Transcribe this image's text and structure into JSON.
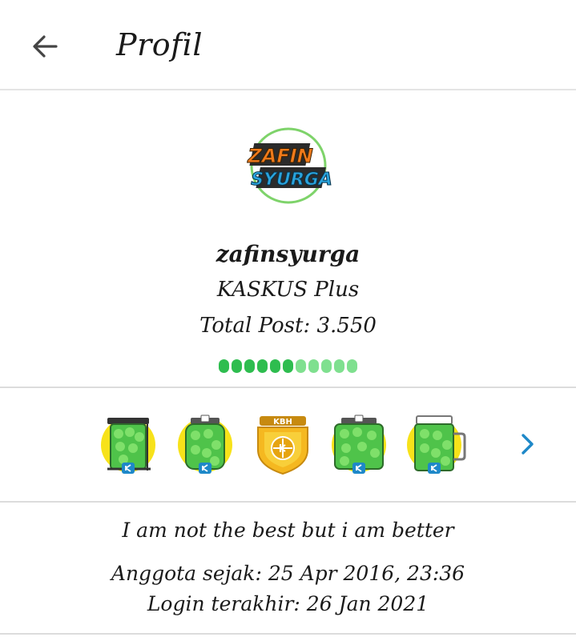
{
  "header": {
    "title": "Profil",
    "back_icon": "arrow-left-icon"
  },
  "profile": {
    "avatar_text_line1": "ZAFIN",
    "avatar_text_line2": "SYURGA",
    "username": "zafinsyurga",
    "rank": "KASKUS Plus",
    "total_post": "Total Post: 3.550",
    "reputation": {
      "filled": 6,
      "total": 11
    }
  },
  "badges": {
    "items": [
      {
        "icon": "kaskus-tower-badge-icon"
      },
      {
        "icon": "kaskus-jar-badge-icon"
      },
      {
        "icon": "kbh-shield-badge-icon",
        "label": "KBH"
      },
      {
        "icon": "kaskus-box-badge-icon"
      },
      {
        "icon": "kaskus-mug-badge-icon"
      }
    ],
    "next_icon": "chevron-right-icon"
  },
  "about": {
    "bio": "I am not the best but i am better",
    "joined": "Anggota sejak: 25 Apr 2016, 23:36",
    "last_login": "Login terakhir: 26 Jan 2021"
  },
  "colors": {
    "accent_blue": "#1e88c8",
    "rep_dark": "#2ebd4f",
    "rep_light": "#7fe08f",
    "badge_yellow": "#f7e21a",
    "badge_green": "#4fc34a"
  }
}
